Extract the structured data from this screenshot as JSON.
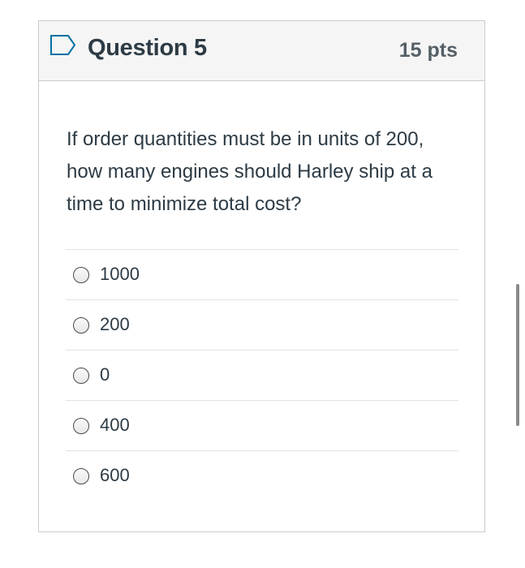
{
  "question": {
    "title": "Question 5",
    "points": "15 pts",
    "text": "If order quantities must be in units of 200, how many engines should Harley ship at a time to minimize total cost?",
    "flag_icon": "flag-outline-icon"
  },
  "answers": [
    {
      "label": "1000",
      "selected": false
    },
    {
      "label": "200",
      "selected": false
    },
    {
      "label": "0",
      "selected": false
    },
    {
      "label": "400",
      "selected": false
    },
    {
      "label": "600",
      "selected": false
    }
  ],
  "colors": {
    "header_bg": "#f5f5f5",
    "border": "#c7cdd1",
    "text": "#2d3b45",
    "flag": "#0770a3"
  }
}
